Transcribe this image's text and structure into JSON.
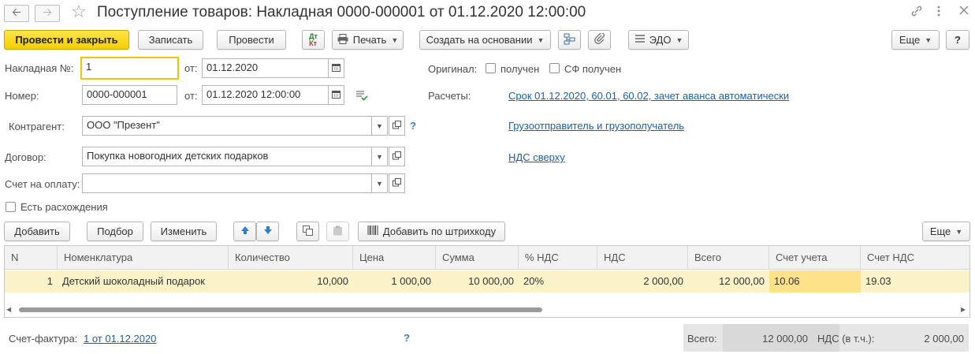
{
  "window": {
    "title": "Поступление товаров: Накладная 0000-000001 от 01.12.2020 12:00:00",
    "back_icon": "arrow-left-icon",
    "forward_icon": "arrow-right-icon",
    "favorite_icon": "star-icon",
    "link_icon": "link-icon",
    "menu_icon": "more-vertical-icon",
    "close_icon": "close-icon"
  },
  "toolbar": {
    "post_close": "Провести и закрыть",
    "save": "Записать",
    "post": "Провести",
    "dtkt_icon": "dt-kt-icon",
    "print": "Печать",
    "create_based": "Создать на основании",
    "structure_icon": "structure-icon",
    "attach_icon": "paperclip-icon",
    "edo": "ЭДО",
    "more": "Еще",
    "help": "?"
  },
  "form": {
    "invoice_no_label": "Накладная №:",
    "invoice_no_value": "1",
    "from_label": "от:",
    "invoice_date": "01.12.2020",
    "number_label": "Номер:",
    "number_value": "0000-000001",
    "number_date": "01.12.2020 12:00:00",
    "contractor_label": "Контрагент:",
    "contractor_value": "ООО \"Презент\"",
    "contract_label": "Договор:",
    "contract_value": "Покупка новогодних детских подарков",
    "payment_invoice_label": "Счет на оплату:",
    "payment_invoice_value": "",
    "discrepancies_label": "Есть расхождения",
    "original_label": "Оригинал:",
    "received_label": "получен",
    "sf_received_label": "СФ получен",
    "settlements_label": "Расчеты:",
    "settlements_link": "Срок 01.12.2020, 60.01, 60.02, зачет аванса автоматически",
    "shipper_link": "Грузоотправитель и грузополучатель",
    "vat_link": "НДС сверху",
    "help_mark": "?"
  },
  "table_toolbar": {
    "add": "Добавить",
    "pick": "Подбор",
    "change": "Изменить",
    "up_icon": "arrow-up-icon",
    "down_icon": "arrow-down-icon",
    "copy_icon": "copy-icon",
    "paste_icon": "paste-icon",
    "barcode_icon": "barcode-icon",
    "add_barcode": "Добавить по штрихкоду",
    "more": "Еще"
  },
  "table": {
    "columns": [
      "N",
      "Номенклатура",
      "Количество",
      "Цена",
      "Сумма",
      "% НДС",
      "НДС",
      "Всего",
      "Счет учета",
      "Счет НДС"
    ],
    "rows": [
      [
        "1",
        "Детский шоколадный подарок",
        "10,000",
        "1 000,00",
        "10 000,00",
        "20%",
        "2 000,00",
        "12 000,00",
        "10.06",
        "19.03"
      ]
    ]
  },
  "footer": {
    "invoice_label": "Счет-фактура:",
    "invoice_link": "1 от 01.12.2020",
    "help_mark": "?",
    "total_label": "Всего:",
    "total_value": "12 000,00",
    "vat_label": "НДС (в т.ч.):",
    "vat_value": "2 000,00"
  },
  "colors": {
    "primary_button": "#f5cf00",
    "link": "#1f5fa5",
    "selected_row": "#fbf2c7",
    "selected_cell": "#fde28a",
    "focus_border": "#f2c30b"
  }
}
